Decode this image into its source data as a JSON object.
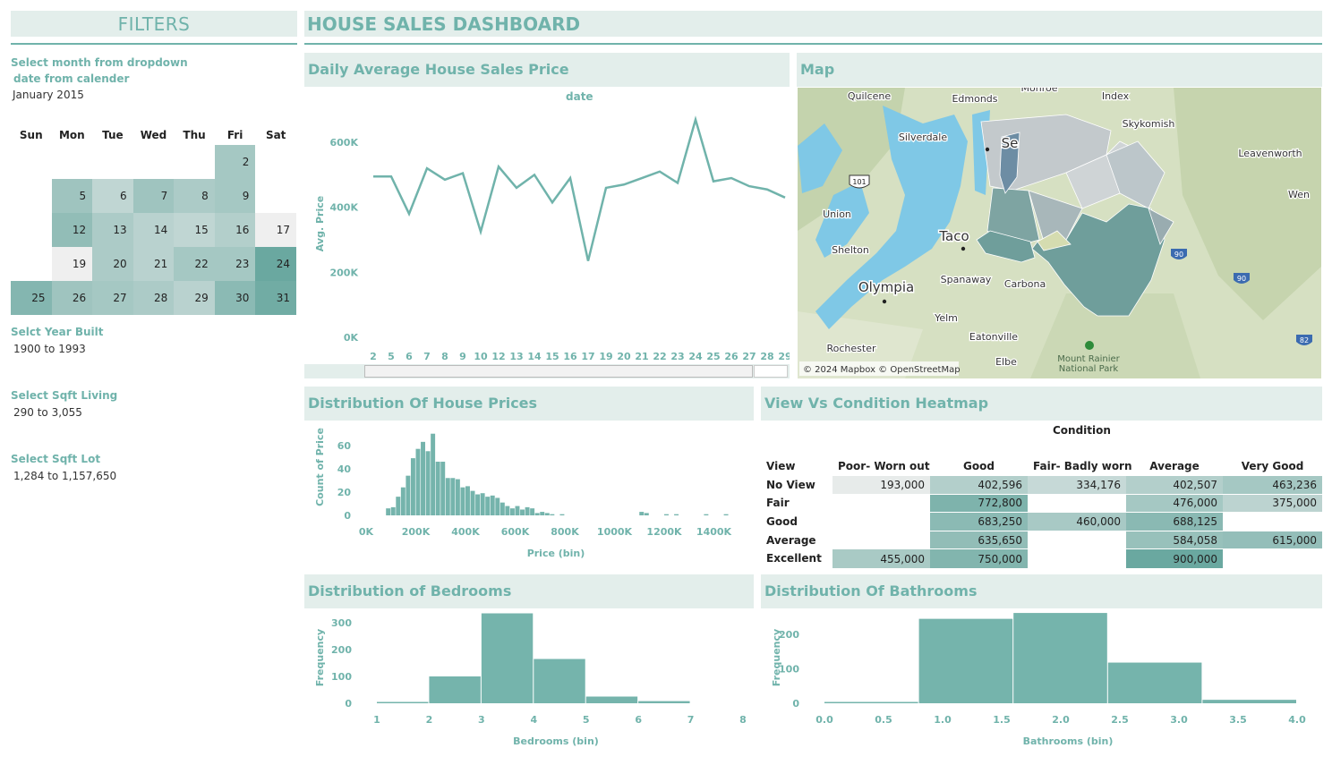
{
  "filters": {
    "title": "FILTERS",
    "calendar_label_line1": "Select month from dropdown",
    "calendar_label_line2": "date from calender",
    "month_value": "January 2015",
    "weekdays": [
      "Sun",
      "Mon",
      "Tue",
      "Wed",
      "Thu",
      "Fri",
      "Sat"
    ],
    "year_label": "Selct Year Built",
    "year_value": "1900 to 1993",
    "sqft_living_label": "Select Sqft Living",
    "sqft_living_value": "290 to 3,055",
    "sqft_lot_label": "Select Sqft Lot",
    "sqft_lot_value": "1,284 to 1,157,650"
  },
  "calendar_weeks": [
    [
      null,
      null,
      null,
      null,
      null,
      {
        "day": "2",
        "shade": 0.55
      },
      null
    ],
    [
      null,
      {
        "day": "5",
        "shade": 0.6
      },
      {
        "day": "6",
        "shade": 0.35
      },
      {
        "day": "7",
        "shade": 0.6
      },
      {
        "day": "8",
        "shade": 0.5
      },
      {
        "day": "9",
        "shade": 0.55
      },
      null
    ],
    [
      null,
      {
        "day": "12",
        "shade": 0.7
      },
      {
        "day": "13",
        "shade": 0.5
      },
      {
        "day": "14",
        "shade": 0.4
      },
      {
        "day": "15",
        "shade": 0.35
      },
      {
        "day": "16",
        "shade": 0.45
      },
      {
        "day": "17",
        "shade": 0.0
      }
    ],
    [
      null,
      {
        "day": "19",
        "shade": 0.0
      },
      {
        "day": "20",
        "shade": 0.5
      },
      {
        "day": "21",
        "shade": 0.4
      },
      {
        "day": "22",
        "shade": 0.55
      },
      {
        "day": "23",
        "shade": 0.55
      },
      {
        "day": "24",
        "shade": 1.0
      }
    ],
    [
      {
        "day": "25",
        "shade": 0.8
      },
      {
        "day": "26",
        "shade": 0.6
      },
      {
        "day": "27",
        "shade": 0.55
      },
      {
        "day": "28",
        "shade": 0.5
      },
      {
        "day": "29",
        "shade": 0.4
      },
      {
        "day": "30",
        "shade": 0.75
      },
      {
        "day": "31",
        "shade": 0.95
      }
    ]
  ],
  "header": {
    "title": "HOUSE SALES DASHBOARD"
  },
  "line_chart": {
    "title": "Daily Average House Sales Price",
    "top_label": "date",
    "chart_data": {
      "type": "line",
      "x": [
        "2",
        "5",
        "6",
        "7",
        "8",
        "9",
        "10",
        "12",
        "13",
        "14",
        "15",
        "16",
        "17",
        "19",
        "20",
        "21",
        "22",
        "23",
        "24",
        "25",
        "26",
        "27",
        "28",
        "29"
      ],
      "y": [
        495000,
        495000,
        380000,
        520000,
        485000,
        505000,
        325000,
        525000,
        460000,
        500000,
        415000,
        490000,
        235000,
        460000,
        470000,
        490000,
        510000,
        475000,
        670000,
        480000,
        490000,
        465000,
        455000,
        430000
      ],
      "ylabel": "Avg. Price",
      "yticks": [
        "0K",
        "200K",
        "400K",
        "600K"
      ],
      "ylim": [
        0,
        680000
      ]
    }
  },
  "map": {
    "title": "Map",
    "attribution": "© 2024 Mapbox © OpenStreetMap",
    "places": [
      "Quilcene",
      "Edmonds",
      "Monroe",
      "Index",
      "Skykomish",
      "Leavenworth",
      "Silverdale",
      "Se",
      "Wen",
      "Union",
      "Taco",
      "Shelton",
      "Olympia",
      "Spanaway",
      "Carbona",
      "Yelm",
      "Eatonville",
      "Rochester",
      "Elbe",
      "Mount Rainier National Park"
    ],
    "shields": [
      "101",
      "90",
      "90",
      "82"
    ]
  },
  "price_hist": {
    "title": "Distribution Of House Prices",
    "chart_data": {
      "type": "bar",
      "xlabel": "Price (bin)",
      "ylabel": "Count of Price",
      "xticks": [
        "0K",
        "200K",
        "400K",
        "600K",
        "800K",
        "1000K",
        "1200K",
        "1400K"
      ],
      "yticks": [
        "0",
        "20",
        "40",
        "60"
      ],
      "bin_width": 20000,
      "bin_starts": [
        80000,
        100000,
        120000,
        140000,
        160000,
        180000,
        200000,
        220000,
        240000,
        260000,
        280000,
        300000,
        320000,
        340000,
        360000,
        380000,
        400000,
        420000,
        440000,
        460000,
        480000,
        500000,
        520000,
        540000,
        560000,
        580000,
        600000,
        620000,
        640000,
        660000,
        680000,
        700000,
        720000,
        740000,
        760000,
        780000,
        800000,
        820000,
        840000,
        860000,
        880000,
        900000,
        920000,
        940000,
        960000,
        980000,
        1000000,
        1060000,
        1100000,
        1120000,
        1180000,
        1200000,
        1240000,
        1360000,
        1440000
      ],
      "values": [
        6,
        7,
        16,
        24,
        34,
        49,
        57,
        63,
        55,
        70,
        46,
        46,
        32,
        32,
        31,
        24,
        25,
        21,
        18,
        19,
        16,
        17,
        15,
        11,
        8,
        6,
        8,
        5,
        7,
        6,
        2,
        3,
        2,
        1,
        0,
        1,
        0,
        0,
        0,
        0,
        0,
        0,
        0,
        0,
        0,
        0,
        0,
        0,
        3,
        2,
        0,
        1,
        1,
        1,
        1
      ],
      "ylim": [
        0,
        72
      ]
    }
  },
  "heatmap": {
    "title": "View Vs Condition Heatmap",
    "condition_label": "Condition",
    "view_label": "View",
    "chart_data": {
      "type": "heatmap",
      "columns": [
        "Poor- Worn out",
        "Good",
        "Fair- Badly worn",
        "Average",
        "Very Good"
      ],
      "rows": [
        {
          "view": "No View",
          "cells": [
            {
              "v": "193,000",
              "s": 0.05
            },
            {
              "v": "402,596",
              "s": 0.45
            },
            {
              "v": "334,176",
              "s": 0.3
            },
            {
              "v": "402,507",
              "s": 0.45
            },
            {
              "v": "463,236",
              "s": 0.55
            }
          ]
        },
        {
          "view": "Fair",
          "cells": [
            {
              "v": "",
              "s": -1
            },
            {
              "v": "772,800",
              "s": 0.85
            },
            {
              "v": "",
              "s": -1
            },
            {
              "v": "476,000",
              "s": 0.55
            },
            {
              "v": "375,000",
              "s": 0.38
            }
          ]
        },
        {
          "view": "Good",
          "cells": [
            {
              "v": "",
              "s": -1
            },
            {
              "v": "683,250",
              "s": 0.75
            },
            {
              "v": "460,000",
              "s": 0.53
            },
            {
              "v": "688,125",
              "s": 0.76
            },
            {
              "v": "",
              "s": -1
            }
          ]
        },
        {
          "view": "Average",
          "cells": [
            {
              "v": "",
              "s": -1
            },
            {
              "v": "635,650",
              "s": 0.7
            },
            {
              "v": "",
              "s": -1
            },
            {
              "v": "584,058",
              "s": 0.65
            },
            {
              "v": "615,000",
              "s": 0.68
            }
          ]
        },
        {
          "view": "Excellent",
          "cells": [
            {
              "v": "455,000",
              "s": 0.52
            },
            {
              "v": "750,000",
              "s": 0.82
            },
            {
              "v": "",
              "s": -1
            },
            {
              "v": "900,000",
              "s": 1.0
            },
            {
              "v": "",
              "s": -1
            }
          ]
        }
      ]
    }
  },
  "bedrooms": {
    "title": "Distribution of Bedrooms",
    "chart_data": {
      "type": "bar",
      "xlabel": "Bedrooms (bin)",
      "ylabel": "Frequency",
      "xticks": [
        "1",
        "2",
        "3",
        "4",
        "5",
        "6",
        "7",
        "8"
      ],
      "yticks": [
        "0",
        "100",
        "200",
        "300"
      ],
      "bin_starts": [
        1,
        2,
        3,
        4,
        5,
        6
      ],
      "values": [
        3,
        100,
        335,
        165,
        25,
        8
      ],
      "ylim": [
        0,
        340
      ],
      "xlim": [
        1,
        8
      ]
    }
  },
  "bathrooms": {
    "title": "Distribution Of Bathrooms",
    "chart_data": {
      "type": "bar",
      "xlabel": "Bathrooms (bin)",
      "ylabel": "Frequency",
      "xticks": [
        "0.0",
        "0.5",
        "1.0",
        "1.5",
        "2.0",
        "2.5",
        "3.0",
        "3.5",
        "4.0"
      ],
      "yticks": [
        "0",
        "100",
        "200"
      ],
      "bin_starts": [
        0,
        0.8,
        1.6,
        2.4,
        3.2
      ],
      "bin_width": 0.8,
      "values": [
        2,
        245,
        262,
        118,
        10
      ],
      "ylim": [
        0,
        270
      ],
      "xlim": [
        0,
        4
      ]
    }
  },
  "colors": {
    "accent": "#70b3ab",
    "header_bg": "#e3eeeb",
    "bar": "#75b4ac"
  }
}
